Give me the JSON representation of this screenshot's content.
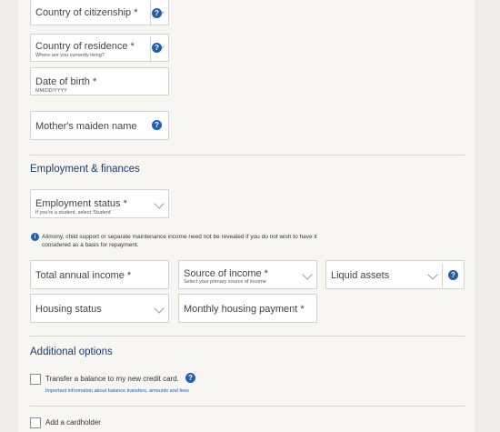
{
  "personal": {
    "citizenship_label": "Country of citizenship *",
    "residence_label": "Country of residence *",
    "residence_hint": "Where are you currently living?",
    "dob_label": "Date of birth *",
    "dob_hint": "MM/DD/YYYY",
    "maiden_label": "Mother's maiden name"
  },
  "employment": {
    "title": "Employment & finances",
    "status_label": "Employment status *",
    "status_hint": "If you're a student, select 'Student'",
    "notice_line1": "Alimony, child support or separate maintenance income need not be revealed if you do not wish to have it",
    "notice_line2": "considered as a basis for repayment.",
    "income_label": "Total annual income *",
    "source_label": "Source of income *",
    "source_hint": "Select your primary source of income",
    "liquid_label": "Liquid assets",
    "housing_status_label": "Housing status",
    "housing_payment_label": "Monthly housing payment *"
  },
  "options": {
    "title": "Additional options",
    "transfer_label": "Transfer a balance to my new credit card.",
    "transfer_link": "Important information about balance transfers, amounts and fees",
    "cardholder_label": "Add a cardholder"
  },
  "icons": {
    "help": "?",
    "info": "i"
  },
  "colors": {
    "accent": "#1f5fb8",
    "section_title": "#1c3a6e",
    "background": "#f7f6f2"
  }
}
